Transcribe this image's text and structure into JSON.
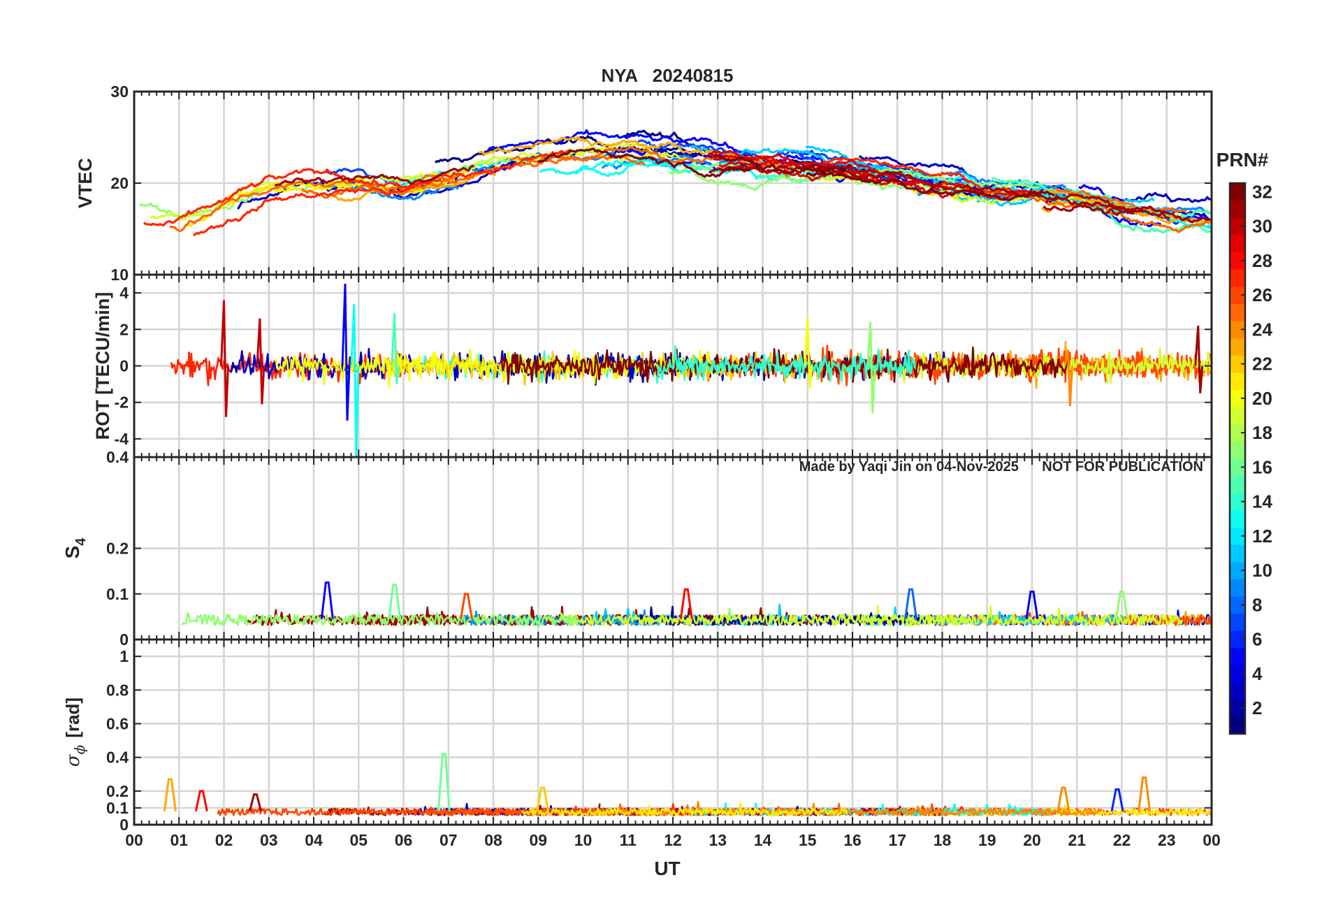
{
  "figure": {
    "title": "NYA   20240815",
    "title_color": "#ff0000",
    "xlabel": "UT",
    "xtick_labels": [
      "00",
      "01",
      "02",
      "03",
      "04",
      "05",
      "06",
      "07",
      "08",
      "09",
      "10",
      "11",
      "12",
      "13",
      "14",
      "15",
      "16",
      "17",
      "18",
      "19",
      "20",
      "21",
      "22",
      "23",
      "00"
    ],
    "watermark": "Made by Yaqi Jin on 04-Nov-2025      NOT FOR PUBLICATION",
    "watermark_color": "#8c8c8c"
  },
  "colorbar": {
    "label": "PRN#",
    "tick_labels": [
      "2",
      "4",
      "6",
      "8",
      "10",
      "12",
      "14",
      "16",
      "18",
      "20",
      "22",
      "24",
      "26",
      "28",
      "30",
      "32"
    ],
    "range": [
      1,
      32
    ],
    "colormap": "jet"
  },
  "chart_data": [
    {
      "type": "line",
      "panel": "vtec",
      "ylabel": "VTEC",
      "xlim": [
        0,
        24
      ],
      "ylim": [
        10,
        30
      ],
      "yticks": [
        10,
        20,
        30
      ],
      "ytick_labels": [
        "10",
        "20",
        "30"
      ],
      "grid": true,
      "series_prn": [
        1,
        3,
        5,
        7,
        9,
        11,
        13,
        15,
        17,
        19,
        21,
        23,
        25,
        27,
        29,
        31,
        32
      ],
      "profile_hours": [
        0,
        1,
        2,
        3,
        4,
        5,
        6,
        7,
        8,
        9,
        10,
        11,
        12,
        13,
        14,
        15,
        16,
        17,
        18,
        19,
        20,
        21,
        22,
        23,
        24
      ],
      "typical_values": [
        16,
        15.5,
        17.5,
        19.5,
        19.8,
        20,
        19.5,
        20.5,
        22,
        23,
        23.5,
        23.5,
        23,
        22.5,
        22,
        22,
        21.5,
        21,
        20,
        19,
        19,
        18.5,
        17.5,
        17,
        16.5
      ]
    },
    {
      "type": "line",
      "panel": "rot",
      "ylabel": "ROT [TECU/min]",
      "xlim": [
        0,
        24
      ],
      "ylim": [
        -5,
        5
      ],
      "yticks": [
        -4,
        -2,
        0,
        2,
        4
      ],
      "ytick_labels": [
        "-4",
        "-2",
        "0",
        "2",
        "4"
      ],
      "grid": true,
      "typical_amplitude": 0.6,
      "spikes": [
        {
          "hour": 2.0,
          "min": -2.8,
          "max": 3.6,
          "prn": 30
        },
        {
          "hour": 2.8,
          "min": -2.1,
          "max": 2.6,
          "prn": 30
        },
        {
          "hour": 4.7,
          "min": -3.0,
          "max": 4.5,
          "prn": 5
        },
        {
          "hour": 4.9,
          "min": -5.0,
          "max": 3.4,
          "prn": 13
        },
        {
          "hour": 5.8,
          "min": -1.0,
          "max": 2.9,
          "prn": 15
        },
        {
          "hour": 15.0,
          "min": -1.2,
          "max": 2.6,
          "prn": 20
        },
        {
          "hour": 16.4,
          "min": -2.6,
          "max": 2.4,
          "prn": 17
        },
        {
          "hour": 20.8,
          "min": -2.2,
          "max": 0.9,
          "prn": 24
        },
        {
          "hour": 23.7,
          "min": -1.5,
          "max": 2.2,
          "prn": 31
        }
      ]
    },
    {
      "type": "line",
      "panel": "s4",
      "ylabel": "S",
      "ylabel_sub": "4",
      "xlim": [
        0,
        24
      ],
      "ylim": [
        0,
        0.4
      ],
      "yticks": [
        0,
        0.1,
        0.2
      ],
      "ytick_labels": [
        "0",
        "0.1",
        "0.2"
      ],
      "top_label": "0.4",
      "grid": true,
      "typical_level": 0.045,
      "peaks": [
        {
          "hour": 4.3,
          "value": 0.125,
          "prn": 5
        },
        {
          "hour": 5.8,
          "value": 0.12,
          "prn": 16
        },
        {
          "hour": 7.4,
          "value": 0.1,
          "prn": 26
        },
        {
          "hour": 12.3,
          "value": 0.11,
          "prn": 28
        },
        {
          "hour": 17.3,
          "value": 0.11,
          "prn": 8
        },
        {
          "hour": 20.0,
          "value": 0.105,
          "prn": 4
        },
        {
          "hour": 22.0,
          "value": 0.105,
          "prn": 17
        }
      ]
    },
    {
      "type": "line",
      "panel": "sigma_phi",
      "ylabel": "σ",
      "ylabel_sub": "ϕ",
      "ylabel_unit": "[rad]",
      "xlim": [
        0,
        24
      ],
      "ylim": [
        0,
        1.1
      ],
      "yticks": [
        0,
        0.1,
        0.2,
        0.4,
        0.6,
        0.8,
        1
      ],
      "ytick_labels": [
        "0",
        "0.1",
        "0.2",
        "0.4",
        "0.6",
        "0.8",
        "1"
      ],
      "grid": true,
      "typical_level": 0.08,
      "peaks": [
        {
          "hour": 0.8,
          "value": 0.27,
          "prn": 23
        },
        {
          "hour": 1.5,
          "value": 0.2,
          "prn": 28
        },
        {
          "hour": 2.7,
          "value": 0.18,
          "prn": 31
        },
        {
          "hour": 6.9,
          "value": 0.42,
          "prn": 16
        },
        {
          "hour": 9.1,
          "value": 0.22,
          "prn": 22
        },
        {
          "hour": 20.7,
          "value": 0.22,
          "prn": 24
        },
        {
          "hour": 21.9,
          "value": 0.21,
          "prn": 6
        },
        {
          "hour": 22.5,
          "value": 0.28,
          "prn": 24
        }
      ]
    }
  ]
}
